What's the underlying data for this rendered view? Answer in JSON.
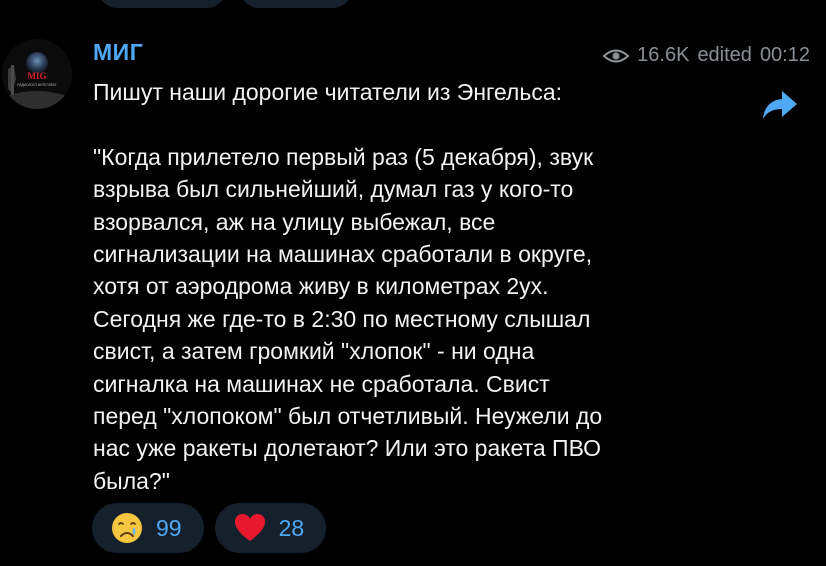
{
  "post": {
    "channel_name": "МИГ",
    "views": "16.6K",
    "edited_label": "edited",
    "time": "00:12",
    "text": "Пишут наши дорогие читатели из Энгельса:\n\n\"Когда прилетело первый раз (5 декабря), звук\nвзрыва был сильнейший, думал газ у кого-то\nвзорвался, аж на улицу выбежал, все\nсигнализации на машинах сработали в округе,\nхотя от аэродрома живу в километрах 2ух.\nСегодня же где-то в 2:30 по местному слышал\nсвист, а затем громкий \"хлопок\" - ни одна\nсигналка на машинах не сработала. Свист\nперед \"хлопоком\" был отчетливый. Неужели до\nнас уже ракеты долетают? Или это ракета ПВО\nбыла?\""
  },
  "avatar": {
    "logo_text": "MIG",
    "tagline": "РАДИОЛОГО ИНТЕЛЛЕКТ"
  },
  "reactions": [
    {
      "icon": "crying-face-icon",
      "count": "99"
    },
    {
      "icon": "heart-icon",
      "count": "28"
    }
  ],
  "colors": {
    "background": "#000000",
    "accent": "#4ea8f5",
    "pill": "#15202d",
    "meta": "#8a8f96",
    "text": "#f2f2f2"
  }
}
